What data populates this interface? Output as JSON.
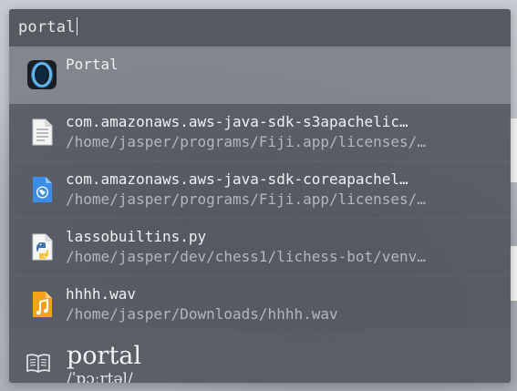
{
  "search": {
    "query": "portal"
  },
  "results": [
    {
      "icon": "portal-app-icon",
      "title": "Portal",
      "subtitle": ""
    },
    {
      "icon": "text-document-icon",
      "title": "com.amazonaws.aws-java-sdk-s3apachelic…",
      "subtitle": "/home/jasper/programs/Fiji.app/licenses/…"
    },
    {
      "icon": "html-document-icon",
      "title": "com.amazonaws.aws-java-sdk-coreapachel…",
      "subtitle": "/home/jasper/programs/Fiji.app/licenses/…"
    },
    {
      "icon": "python-file-icon",
      "title": "lassobuiltins.py",
      "subtitle": "/home/jasper/dev/chess1/lichess-bot/venv…"
    },
    {
      "icon": "audio-file-icon",
      "title": "hhhh.wav",
      "subtitle": "/home/jasper/Downloads/hhhh.wav"
    }
  ],
  "dictionary": {
    "icon": "book-icon",
    "word": "portal",
    "pronunciation": "/ˈpɔːrtəl/"
  },
  "colors": {
    "selected_row": "#969aa2",
    "panel": "#4c5058",
    "text": "#eef0f3",
    "subtext": "#b3b8bf"
  }
}
